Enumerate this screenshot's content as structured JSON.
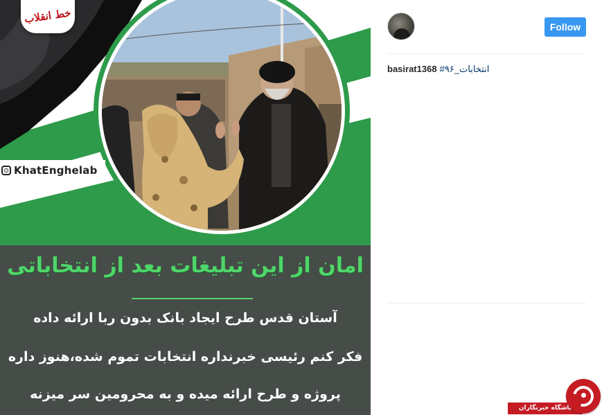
{
  "post": {
    "image": {
      "brand_logo_text": "خط انقلاب",
      "handle": "KhatEnghelab",
      "headline": "امان از این تبلیغات بعد از انتخاباتی",
      "lines": [
        "آستان قدس طرح ایجاد بانک بدون ربا ارائه داده",
        "فکر کنم رئیسی خبرنداره انتخابات تموم شده،هنوز داره",
        "پروژه و طرح ارائه میده و به محرومین سر میزنه"
      ]
    }
  },
  "sidebar": {
    "avatar_icon": "user-avatar",
    "follow_label": "Follow",
    "caption_user": "basirat1368",
    "caption_hashtag": "#انتخابات_۹۶"
  },
  "watermark": {
    "label": "باشگاه خبرنگاران"
  },
  "colors": {
    "follow_button": "#3897f0",
    "hashtag": "#003569",
    "panel_bg": "#464c48",
    "headline_green": "#4fd66a",
    "watermark_red": "#c51b23"
  }
}
